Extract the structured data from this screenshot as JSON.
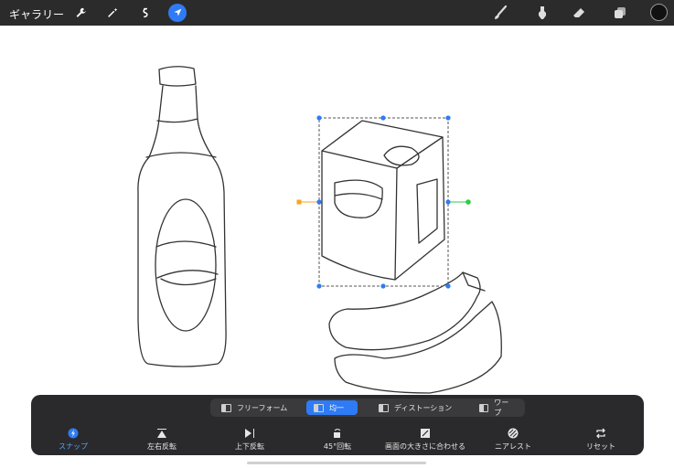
{
  "topbar": {
    "gallery_label": "ギャラリー",
    "left_icons": [
      "wrench-icon",
      "magic-wand-icon",
      "selection-icon",
      "transform-arrow-icon"
    ],
    "right_icons": [
      "brush-icon",
      "smudge-icon",
      "eraser-icon",
      "layers-icon"
    ],
    "current_color": "#111111"
  },
  "transform_panel": {
    "modes": [
      {
        "label": "フリーフォーム",
        "icon": "freeform-icon",
        "active": false
      },
      {
        "label": "均一",
        "icon": "uniform-icon",
        "active": true
      },
      {
        "label": "ディストーション",
        "icon": "distort-icon",
        "active": false
      },
      {
        "label": "ワープ",
        "icon": "warp-icon",
        "active": false
      }
    ],
    "actions": [
      {
        "label": "スナップ",
        "icon": "snap-icon",
        "active": true
      },
      {
        "label": "左右反転",
        "icon": "flip-horizontal-icon"
      },
      {
        "label": "上下反転",
        "icon": "flip-vertical-icon"
      },
      {
        "label": "45°回転",
        "icon": "rotate-45-icon"
      },
      {
        "label": "画面の大きさに合わせる",
        "icon": "fit-to-screen-icon"
      },
      {
        "label": "ニアレスト",
        "icon": "nearest-icon"
      },
      {
        "label": "リセット",
        "icon": "reset-icon"
      }
    ]
  },
  "colors": {
    "accent": "#2f7bf5",
    "handle_orange": "#f5a623",
    "handle_green": "#2ecc40"
  }
}
